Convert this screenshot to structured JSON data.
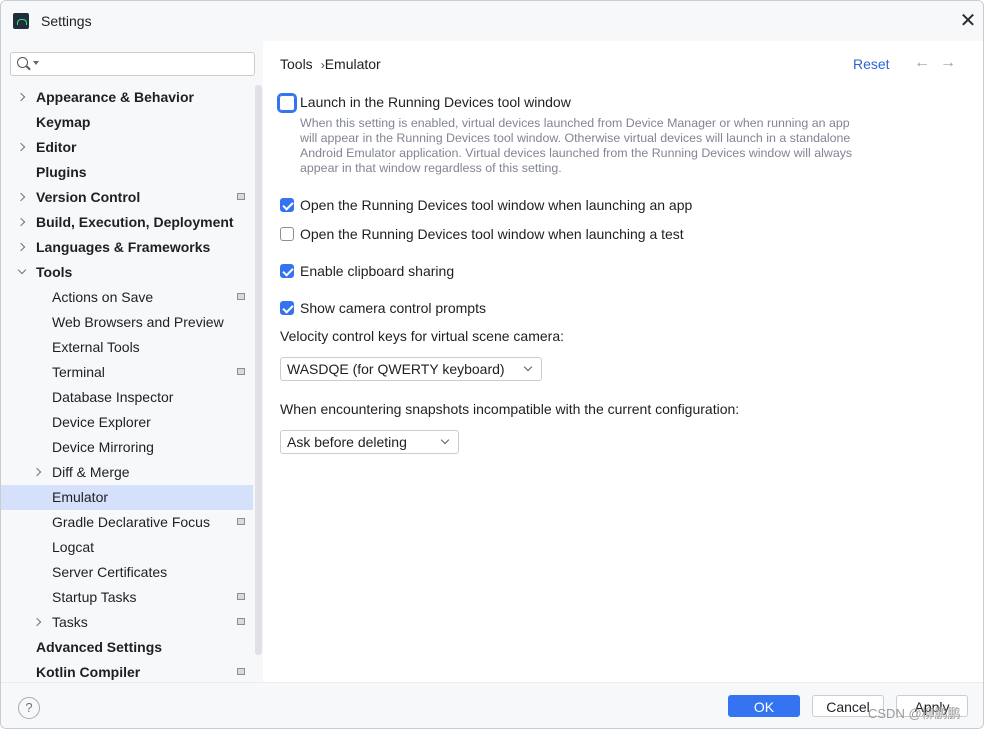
{
  "window": {
    "title": "Settings",
    "close_glyph": "✕"
  },
  "sidebar": {
    "search_placeholder": "",
    "items": [
      {
        "label": "Appearance & Behavior",
        "level": 0,
        "bold": true,
        "expander": "collapsed",
        "project_icon": false
      },
      {
        "label": "Keymap",
        "level": 0,
        "bold": true,
        "expander": "none",
        "project_icon": false
      },
      {
        "label": "Editor",
        "level": 0,
        "bold": true,
        "expander": "collapsed",
        "project_icon": false
      },
      {
        "label": "Plugins",
        "level": 0,
        "bold": true,
        "expander": "none",
        "project_icon": false
      },
      {
        "label": "Version Control",
        "level": 0,
        "bold": true,
        "expander": "collapsed",
        "project_icon": true
      },
      {
        "label": "Build, Execution, Deployment",
        "level": 0,
        "bold": true,
        "expander": "collapsed",
        "project_icon": false
      },
      {
        "label": "Languages & Frameworks",
        "level": 0,
        "bold": true,
        "expander": "collapsed",
        "project_icon": false
      },
      {
        "label": "Tools",
        "level": 0,
        "bold": true,
        "expander": "expanded",
        "project_icon": false
      },
      {
        "label": "Actions on Save",
        "level": 1,
        "bold": false,
        "expander": "none",
        "project_icon": true
      },
      {
        "label": "Web Browsers and Preview",
        "level": 1,
        "bold": false,
        "expander": "none",
        "project_icon": false
      },
      {
        "label": "External Tools",
        "level": 1,
        "bold": false,
        "expander": "none",
        "project_icon": false
      },
      {
        "label": "Terminal",
        "level": 1,
        "bold": false,
        "expander": "none",
        "project_icon": true
      },
      {
        "label": "Database Inspector",
        "level": 1,
        "bold": false,
        "expander": "none",
        "project_icon": false
      },
      {
        "label": "Device Explorer",
        "level": 1,
        "bold": false,
        "expander": "none",
        "project_icon": false
      },
      {
        "label": "Device Mirroring",
        "level": 1,
        "bold": false,
        "expander": "none",
        "project_icon": false
      },
      {
        "label": "Diff & Merge",
        "level": 1,
        "bold": false,
        "expander": "collapsed",
        "project_icon": false
      },
      {
        "label": "Emulator",
        "level": 1,
        "bold": false,
        "expander": "none",
        "project_icon": false,
        "selected": true
      },
      {
        "label": "Gradle Declarative Focus",
        "level": 1,
        "bold": false,
        "expander": "none",
        "project_icon": true
      },
      {
        "label": "Logcat",
        "level": 1,
        "bold": false,
        "expander": "none",
        "project_icon": false
      },
      {
        "label": "Server Certificates",
        "level": 1,
        "bold": false,
        "expander": "none",
        "project_icon": false
      },
      {
        "label": "Startup Tasks",
        "level": 1,
        "bold": false,
        "expander": "none",
        "project_icon": true
      },
      {
        "label": "Tasks",
        "level": 1,
        "bold": false,
        "expander": "collapsed",
        "project_icon": true
      },
      {
        "label": "Advanced Settings",
        "level": 0,
        "bold": true,
        "expander": "none",
        "project_icon": false
      },
      {
        "label": "Kotlin Compiler",
        "level": 0,
        "bold": true,
        "expander": "none",
        "project_icon": true
      }
    ]
  },
  "breadcrumb": {
    "parent": "Tools",
    "separator": "›",
    "current": "Emulator"
  },
  "header": {
    "reset_label": "Reset",
    "back_glyph": "←",
    "forward_glyph": "→"
  },
  "options": {
    "launch_in_running_devices": {
      "label": "Launch in the Running Devices tool window",
      "checked": false,
      "description": "When this setting is enabled, virtual devices launched from Device Manager or when running an app will appear in the Running Devices tool window. Otherwise virtual devices will launch in a standalone Android Emulator application. Virtual devices launched from the Running Devices window will always appear in that window regardless of this setting."
    },
    "open_when_launching_app": {
      "label": "Open the Running Devices tool window when launching an app",
      "checked": true
    },
    "open_when_launching_test": {
      "label": "Open the Running Devices tool window when launching a test",
      "checked": false
    },
    "clipboard_sharing": {
      "label": "Enable clipboard sharing",
      "checked": true
    },
    "camera_prompts": {
      "label": "Show camera control prompts",
      "checked": true
    }
  },
  "velocity": {
    "label": "Velocity control keys for virtual scene camera:",
    "selected": "WASDQE (for QWERTY keyboard)"
  },
  "snapshots": {
    "label": "When encountering snapshots incompatible with the current configuration:",
    "selected": "Ask before deleting"
  },
  "footer": {
    "help_glyph": "?",
    "ok_label": "OK",
    "cancel_label": "Cancel",
    "apply_label": "Apply"
  },
  "watermark": "CSDN @柳鹏鹏",
  "colors": {
    "accent": "#3574f0",
    "selection": "#d5e1fb",
    "link": "#2f64d0"
  }
}
